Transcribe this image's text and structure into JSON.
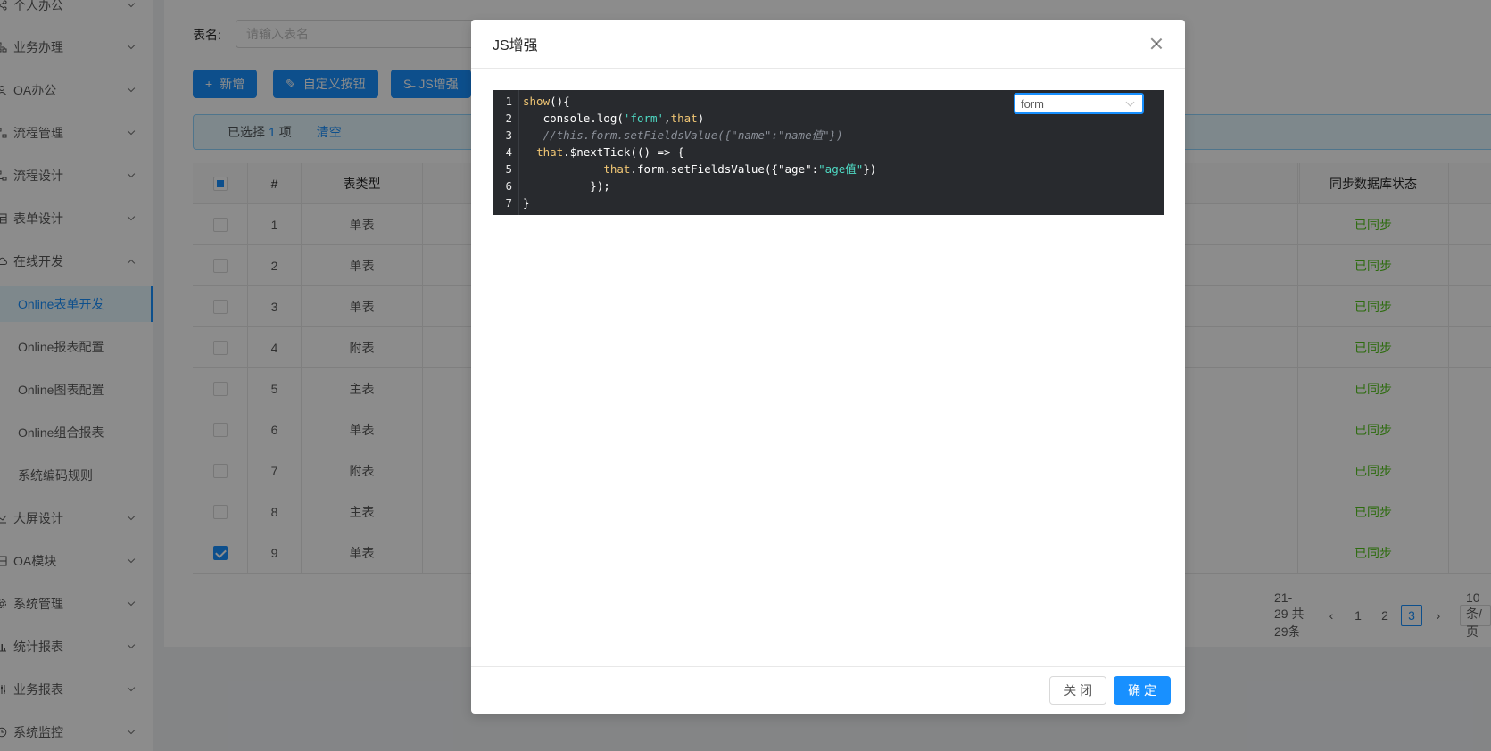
{
  "sidebar": {
    "items": [
      {
        "label": "个人办公",
        "icon": "share-icon",
        "expanded": false
      },
      {
        "label": "业务办理",
        "icon": "apartment-icon",
        "expanded": false
      },
      {
        "label": "OA办公",
        "icon": "user-icon",
        "expanded": false
      },
      {
        "label": "流程管理",
        "icon": "flow-icon",
        "expanded": false
      },
      {
        "label": "流程设计",
        "icon": "flow-icon",
        "expanded": false
      },
      {
        "label": "表单设计",
        "icon": "form-icon",
        "expanded": false
      },
      {
        "label": "在线开发",
        "icon": "cloud-icon",
        "expanded": true
      },
      {
        "label": "大屏设计",
        "icon": "dashboard-icon",
        "expanded": false
      },
      {
        "label": "OA模块",
        "icon": "module-icon",
        "expanded": false
      },
      {
        "label": "系统管理",
        "icon": "gear-icon",
        "expanded": false
      },
      {
        "label": "统计报表",
        "icon": "bar-chart-icon",
        "expanded": false
      },
      {
        "label": "业务报表",
        "icon": "sliders-icon",
        "expanded": false
      },
      {
        "label": "系统监控",
        "icon": "clock-icon",
        "expanded": false
      }
    ],
    "subitems": [
      {
        "label": "Online表单开发",
        "active": true
      },
      {
        "label": "Online报表配置",
        "active": false
      },
      {
        "label": "Online图表配置",
        "active": false
      },
      {
        "label": "Online组合报表",
        "active": false
      },
      {
        "label": "系统编码规则",
        "active": false
      }
    ]
  },
  "search": {
    "label": "表名:",
    "placeholder": "请输入表名"
  },
  "toolbar": {
    "add_label": "新增",
    "custom_button_label": "自定义按钮",
    "js_enhance_label": "JS增强"
  },
  "selection": {
    "prefix": "已选择",
    "count": "1",
    "suffix": "项",
    "clear_label": "清空"
  },
  "table": {
    "headers": {
      "index": "#",
      "type": "表类型",
      "sync_status": "同步数据库状态"
    },
    "rows": [
      {
        "index": "1",
        "type": "单表",
        "sync": "已同步",
        "checked": false
      },
      {
        "index": "2",
        "type": "单表",
        "sync": "已同步",
        "checked": false
      },
      {
        "index": "3",
        "type": "单表",
        "sync": "已同步",
        "checked": false
      },
      {
        "index": "4",
        "type": "附表",
        "sync": "已同步",
        "checked": false
      },
      {
        "index": "5",
        "type": "主表",
        "sync": "已同步",
        "checked": false
      },
      {
        "index": "6",
        "type": "单表",
        "sync": "已同步",
        "checked": false
      },
      {
        "index": "7",
        "type": "附表",
        "sync": "已同步",
        "checked": false
      },
      {
        "index": "8",
        "type": "主表",
        "sync": "已同步",
        "checked": false
      },
      {
        "index": "9",
        "type": "单表",
        "sync": "已同步",
        "checked": true
      }
    ]
  },
  "pagination": {
    "total_text": "21-29 共29条",
    "pages": [
      "1",
      "2",
      "3"
    ],
    "current": "3",
    "page_size": "10 条/页"
  },
  "modal": {
    "title": "JS增强",
    "select_value": "form",
    "code_lines": [
      {
        "n": "1"
      },
      {
        "n": "2"
      },
      {
        "n": "3"
      },
      {
        "n": "4"
      },
      {
        "n": "5"
      },
      {
        "n": "6"
      },
      {
        "n": "7"
      }
    ],
    "code": {
      "l1_fn": "show",
      "l1_rest": "(){",
      "l2_pre": "   console.log(",
      "l2_str": "'form'",
      "l2_sep": ",",
      "l2_this": "that",
      "l2_end": ")",
      "l3_comment": "   //this.form.setFieldsValue({\"name\":\"name值\"})",
      "l4_pre": "  ",
      "l4_this": "that",
      "l4_rest": ".$nextTick(() => {",
      "l5_pre": "            ",
      "l5_this": "that",
      "l5_mid": ".form.setFieldsValue({\"age\":",
      "l5_str": "\"age值\"",
      "l5_end": "})",
      "l6": "          });",
      "l7": "}"
    },
    "close_label": "关 闭",
    "ok_label": "确 定"
  },
  "colors": {
    "primary": "#1890ff",
    "success": "#52c41a",
    "editor_bg": "#282a2e"
  }
}
